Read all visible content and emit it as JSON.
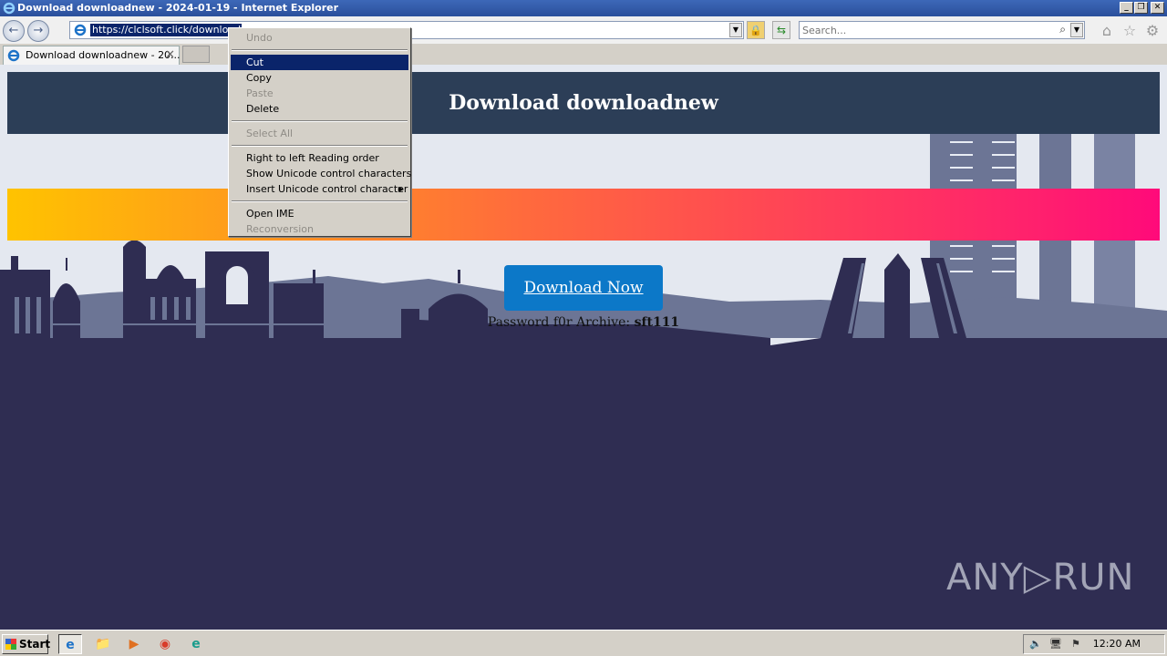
{
  "window": {
    "title": "Download downloadnew - 2024-01-19 - Internet Explorer",
    "buttons": [
      "_",
      "❒",
      "✕"
    ]
  },
  "toolbar": {
    "back_glyph": "←",
    "forward_glyph": "→",
    "address_url": "https://clclsoft.click/downloadne",
    "address_dropdown": "▼",
    "lock_glyph": "🔒",
    "refresh_glyph": "⇆",
    "search_placeholder": "Search...",
    "search_glyph": "⌕",
    "home_glyph": "⌂",
    "favorites_glyph": "☆",
    "tools_glyph": "⚙"
  },
  "tabs": [
    {
      "label": "Download downloadnew - 20...",
      "close": "✕"
    }
  ],
  "page": {
    "header_title": "Download downloadnew",
    "download_button": "Download Now",
    "password_label": "Password f0r Archive:",
    "password_value": "sft111",
    "watermark": "ANY▷RUN"
  },
  "context_menu": {
    "items": [
      {
        "label": "Undo",
        "enabled": false
      },
      {
        "sep": true
      },
      {
        "label": "Cut",
        "enabled": true,
        "selected": true
      },
      {
        "label": "Copy",
        "enabled": true
      },
      {
        "label": "Paste",
        "enabled": false
      },
      {
        "label": "Delete",
        "enabled": true
      },
      {
        "sep": true
      },
      {
        "label": "Select All",
        "enabled": false
      },
      {
        "sep": true
      },
      {
        "label": "Right to left Reading order",
        "enabled": true
      },
      {
        "label": "Show Unicode control characters",
        "enabled": true
      },
      {
        "label": "Insert Unicode control character",
        "enabled": true,
        "submenu": true
      },
      {
        "sep": true
      },
      {
        "label": "Open IME",
        "enabled": true
      },
      {
        "label": "Reconversion",
        "enabled": false
      }
    ]
  },
  "taskbar": {
    "start_label": "Start",
    "apps": [
      {
        "name": "internet-explorer",
        "glyph": "e",
        "active": true
      },
      {
        "name": "file-explorer",
        "glyph": "📁",
        "active": false
      },
      {
        "name": "media-player",
        "glyph": "▶",
        "active": false
      },
      {
        "name": "chrome",
        "glyph": "◉",
        "active": false
      },
      {
        "name": "edge",
        "glyph": "e",
        "active": false
      }
    ],
    "clock": "12:20 AM",
    "tray_glyphs": [
      "🔈",
      "🖥",
      "⚑"
    ]
  },
  "colors": {
    "header_bg": "#2c3e57",
    "button_bg": "#0c78c8",
    "gradient_start": "#ffc300",
    "gradient_end": "#ff0a7a",
    "skyline_dark": "#2f2d52",
    "skyline_light": "#6c7595"
  }
}
